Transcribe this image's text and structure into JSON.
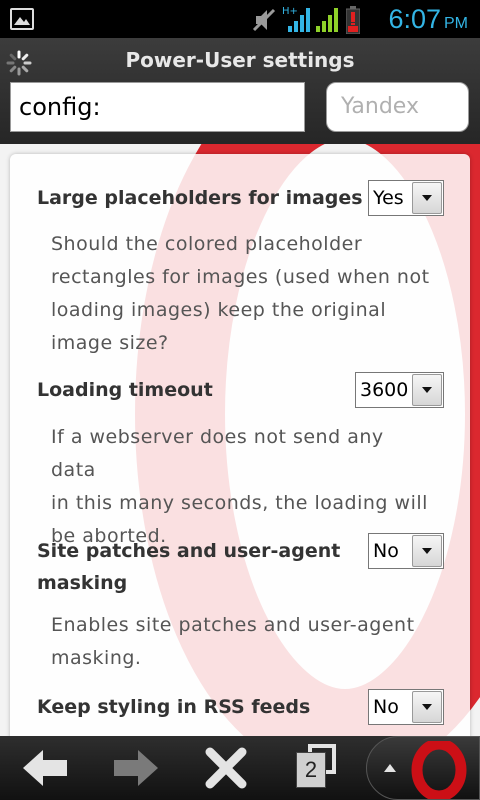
{
  "status": {
    "time": "6:07",
    "ampm": "PM"
  },
  "header": {
    "title": "Power-User settings",
    "url_value": "config:",
    "search_placeholder": "Yandex"
  },
  "settings": [
    {
      "label": "Large placeholders for images",
      "value": "Yes",
      "description": [
        "Should the colored placeholder",
        "rectangles for images (used when not",
        "loading images) keep the original",
        "image size?"
      ]
    },
    {
      "label": "Loading timeout",
      "value": "3600",
      "description": [
        "If a webserver does not send any data",
        "in this many seconds, the loading will",
        "be aborted."
      ]
    },
    {
      "label_lines": [
        "Site patches and user-agent",
        "masking"
      ],
      "value": "No",
      "description": [
        "Enables site patches and user-agent",
        "masking."
      ]
    },
    {
      "label": "Keep styling in RSS feeds",
      "value": "No"
    }
  ],
  "bottombar": {
    "tab_count": "2"
  },
  "colors": {
    "accent": "#33b5e5",
    "opera_red": "#cc0f16"
  }
}
